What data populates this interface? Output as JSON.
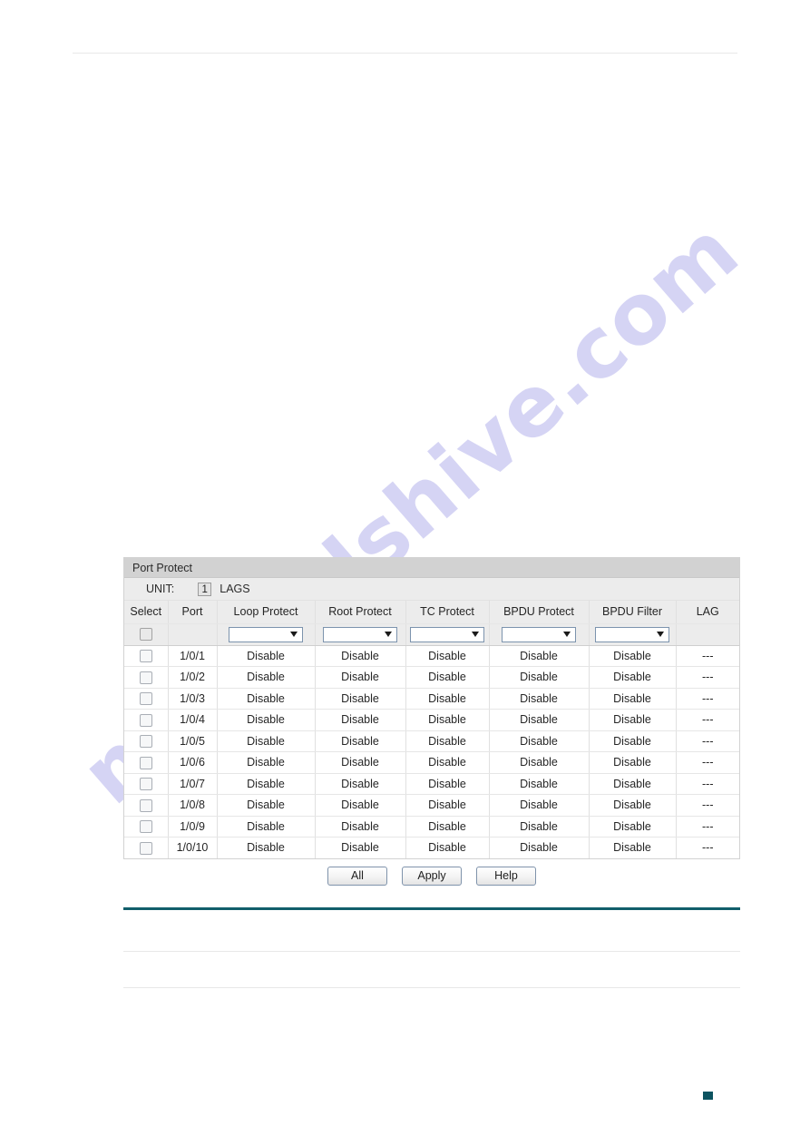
{
  "panel": {
    "title": "Port Protect",
    "unit": {
      "label": "UNIT:",
      "value": "1",
      "lags_label": "LAGS"
    },
    "columns": [
      "Select",
      "Port",
      "Loop Protect",
      "Root Protect",
      "TC Protect",
      "BPDU Protect",
      "BPDU Filter",
      "LAG"
    ],
    "filter_row": {
      "loop_protect": "",
      "root_protect": "",
      "tc_protect": "",
      "bpdu_protect": "",
      "bpdu_filter": ""
    },
    "rows": [
      {
        "port": "1/0/1",
        "loop_protect": "Disable",
        "root_protect": "Disable",
        "tc_protect": "Disable",
        "bpdu_protect": "Disable",
        "bpdu_filter": "Disable",
        "lag": "---"
      },
      {
        "port": "1/0/2",
        "loop_protect": "Disable",
        "root_protect": "Disable",
        "tc_protect": "Disable",
        "bpdu_protect": "Disable",
        "bpdu_filter": "Disable",
        "lag": "---"
      },
      {
        "port": "1/0/3",
        "loop_protect": "Disable",
        "root_protect": "Disable",
        "tc_protect": "Disable",
        "bpdu_protect": "Disable",
        "bpdu_filter": "Disable",
        "lag": "---"
      },
      {
        "port": "1/0/4",
        "loop_protect": "Disable",
        "root_protect": "Disable",
        "tc_protect": "Disable",
        "bpdu_protect": "Disable",
        "bpdu_filter": "Disable",
        "lag": "---"
      },
      {
        "port": "1/0/5",
        "loop_protect": "Disable",
        "root_protect": "Disable",
        "tc_protect": "Disable",
        "bpdu_protect": "Disable",
        "bpdu_filter": "Disable",
        "lag": "---"
      },
      {
        "port": "1/0/6",
        "loop_protect": "Disable",
        "root_protect": "Disable",
        "tc_protect": "Disable",
        "bpdu_protect": "Disable",
        "bpdu_filter": "Disable",
        "lag": "---"
      },
      {
        "port": "1/0/7",
        "loop_protect": "Disable",
        "root_protect": "Disable",
        "tc_protect": "Disable",
        "bpdu_protect": "Disable",
        "bpdu_filter": "Disable",
        "lag": "---"
      },
      {
        "port": "1/0/8",
        "loop_protect": "Disable",
        "root_protect": "Disable",
        "tc_protect": "Disable",
        "bpdu_protect": "Disable",
        "bpdu_filter": "Disable",
        "lag": "---"
      },
      {
        "port": "1/0/9",
        "loop_protect": "Disable",
        "root_protect": "Disable",
        "tc_protect": "Disable",
        "bpdu_protect": "Disable",
        "bpdu_filter": "Disable",
        "lag": "---"
      },
      {
        "port": "1/0/10",
        "loop_protect": "Disable",
        "root_protect": "Disable",
        "tc_protect": "Disable",
        "bpdu_protect": "Disable",
        "bpdu_filter": "Disable",
        "lag": "---"
      }
    ]
  },
  "buttons": {
    "all": "All",
    "apply": "Apply",
    "help": "Help"
  },
  "watermark": {
    "text": "manualshive.com"
  },
  "colors": {
    "accent_rule": "#115e6b",
    "panel_header": "#d2d2d2",
    "row_header": "#ececec",
    "watermark": "#7e7cde"
  }
}
